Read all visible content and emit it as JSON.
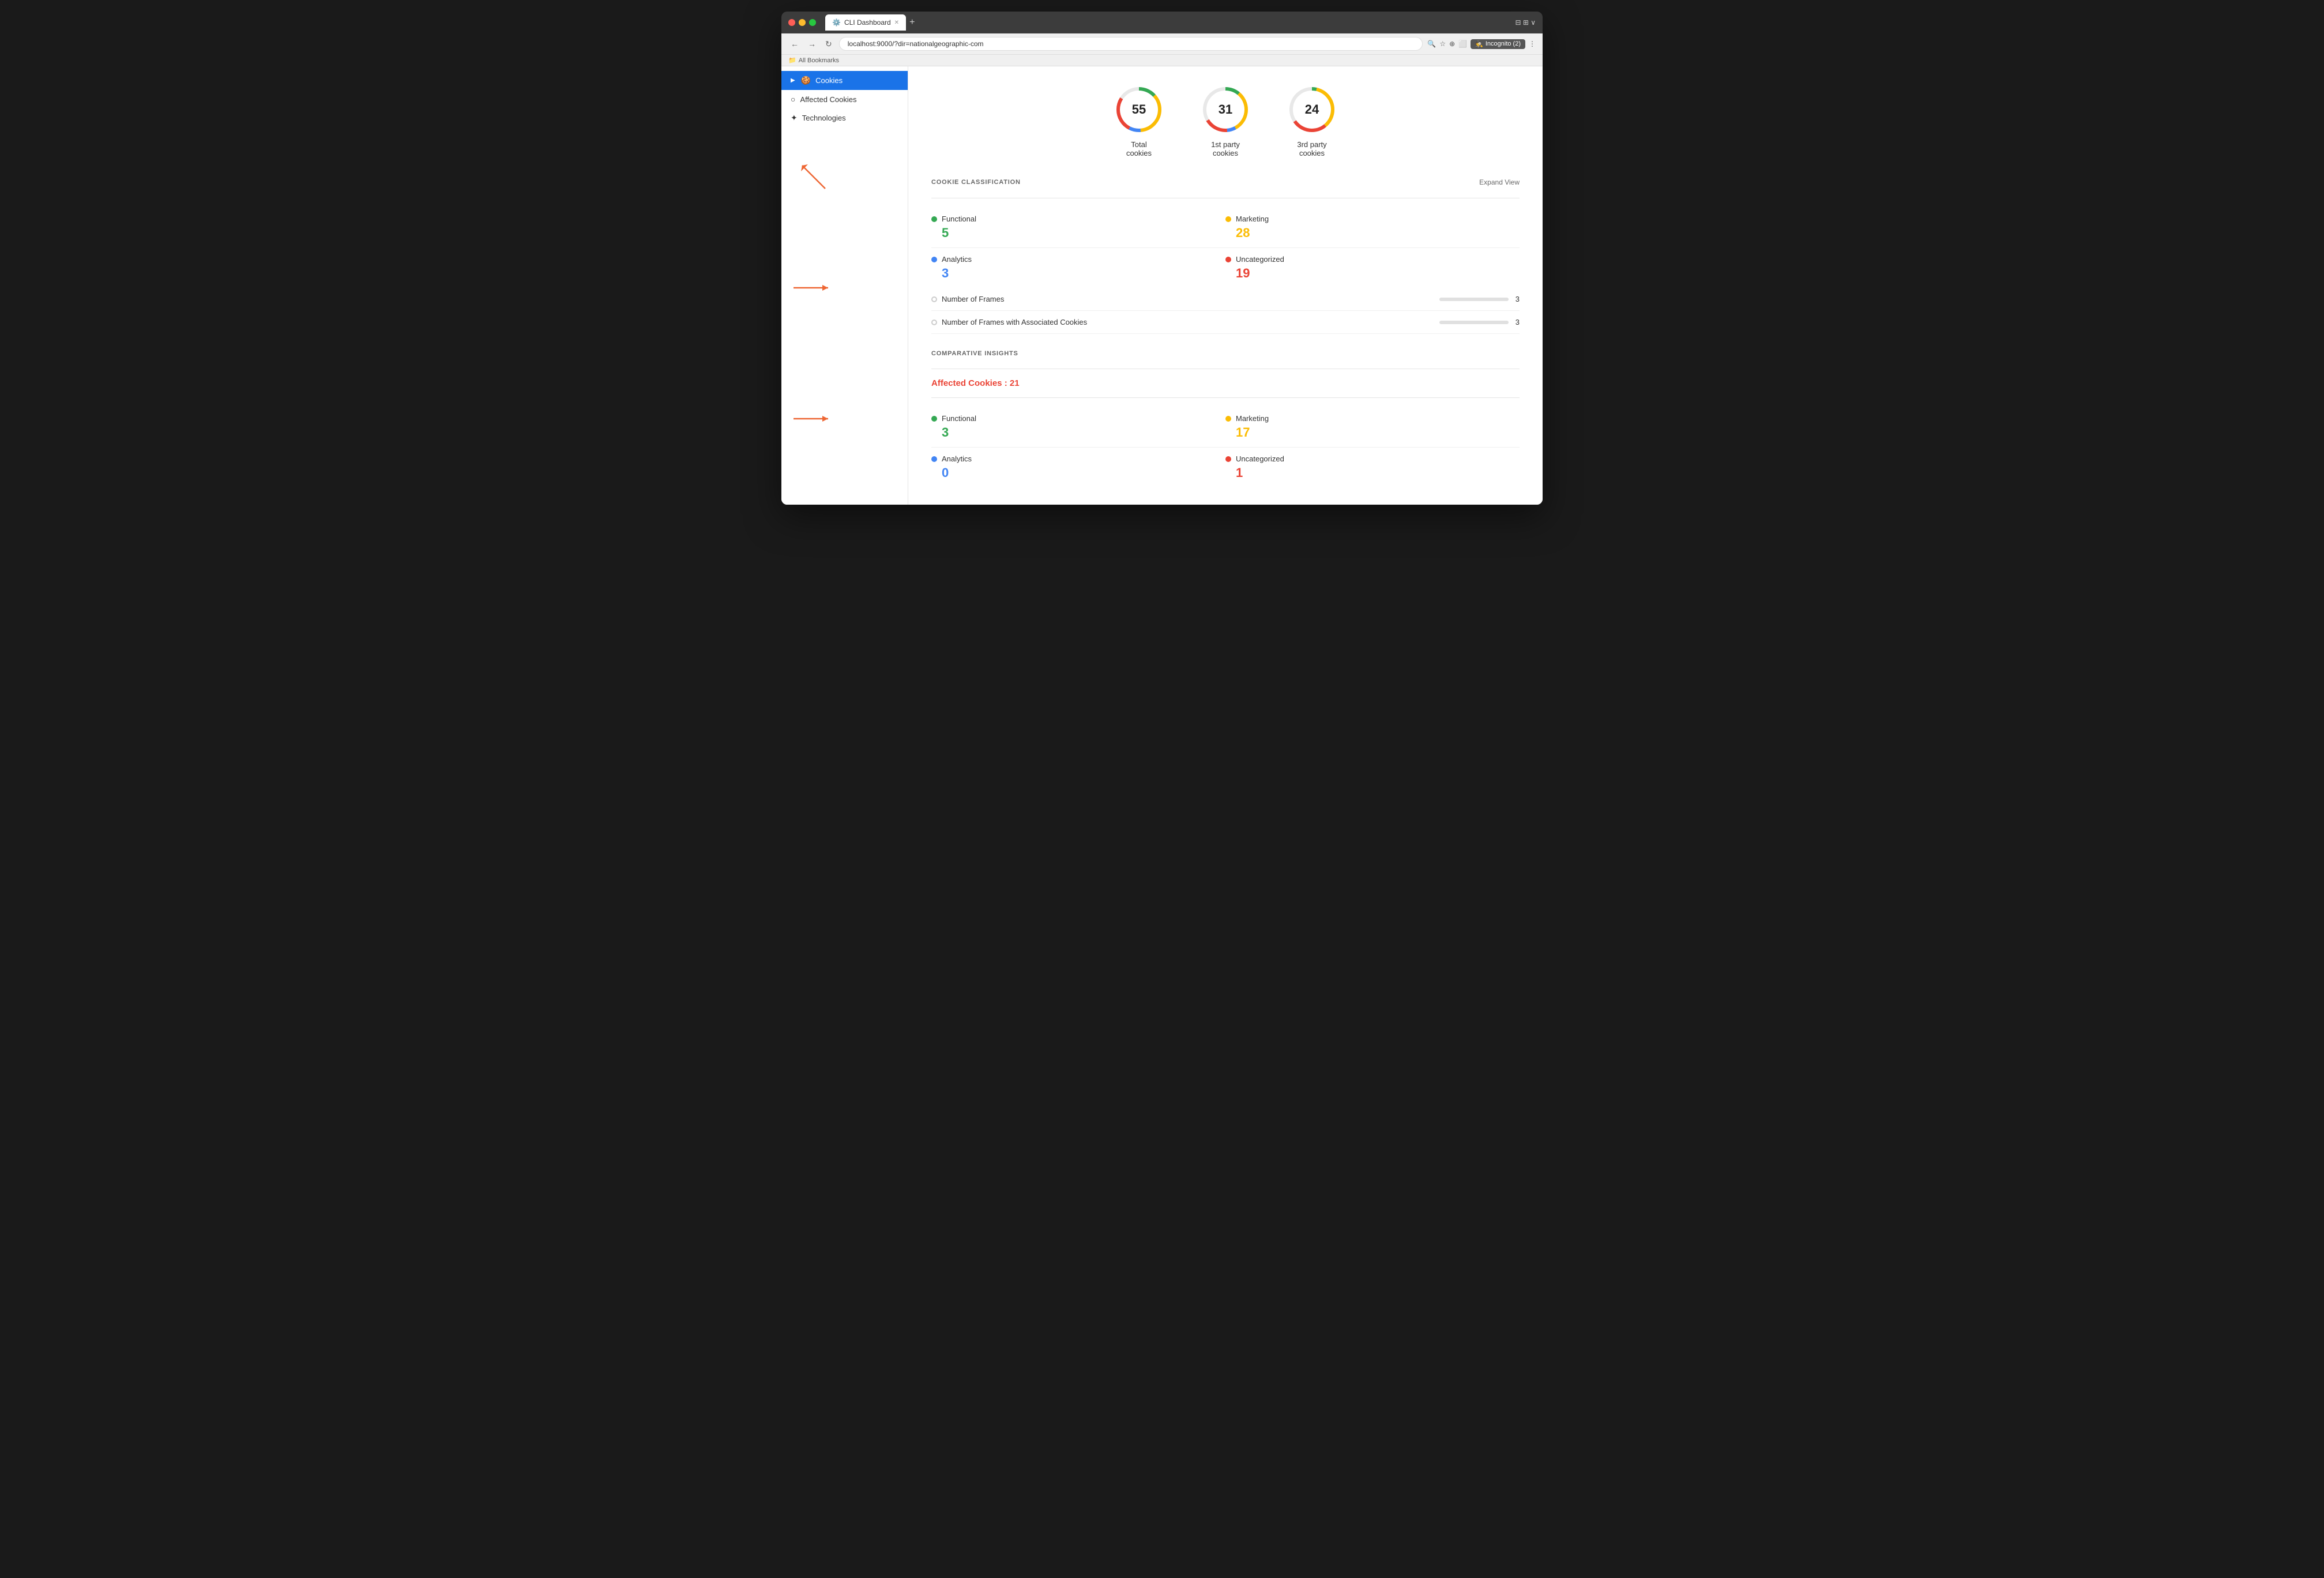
{
  "browser": {
    "tab_title": "CLI Dashboard",
    "url": "localhost:9000/?dir=nationalgeographic-com",
    "incognito_label": "Incognito (2)",
    "bookmarks_label": "All Bookmarks"
  },
  "sidebar": {
    "items": [
      {
        "id": "cookies",
        "label": "Cookies",
        "icon": "🍪",
        "active": true
      },
      {
        "id": "affected-cookies",
        "label": "Affected Cookies",
        "icon": "○",
        "active": false
      },
      {
        "id": "technologies",
        "label": "Technologies",
        "icon": "⊕",
        "active": false
      }
    ]
  },
  "stats": [
    {
      "id": "total",
      "value": "55",
      "title": "Total\ncookies"
    },
    {
      "id": "first-party",
      "value": "31",
      "title": "1st party\ncookies"
    },
    {
      "id": "third-party",
      "value": "24",
      "title": "3rd party\ncookies"
    }
  ],
  "cookie_classification": {
    "section_title": "COOKIE CLASSIFICATION",
    "expand_label": "Expand View",
    "items": [
      {
        "id": "functional",
        "label": "Functional",
        "value": "5",
        "dot": "green",
        "val_color": "green"
      },
      {
        "id": "marketing",
        "label": "Marketing",
        "value": "28",
        "dot": "orange",
        "val_color": "orange"
      },
      {
        "id": "analytics",
        "label": "Analytics",
        "value": "3",
        "dot": "blue",
        "val_color": "blue"
      },
      {
        "id": "uncategorized",
        "label": "Uncategorized",
        "value": "19",
        "dot": "red",
        "val_color": "red"
      }
    ],
    "frames": [
      {
        "id": "frames",
        "label": "Number of Frames",
        "value": "3"
      },
      {
        "id": "frames-with-cookies",
        "label": "Number of Frames with Associated Cookies",
        "value": "3"
      }
    ]
  },
  "comparative_insights": {
    "section_title": "COMPARATIVE INSIGHTS",
    "affected_label": "Affected Cookies : 21",
    "items": [
      {
        "id": "functional",
        "label": "Functional",
        "value": "3",
        "dot": "green",
        "val_color": "green"
      },
      {
        "id": "marketing",
        "label": "Marketing",
        "value": "17",
        "dot": "orange",
        "val_color": "orange"
      },
      {
        "id": "analytics",
        "label": "Analytics",
        "value": "0",
        "dot": "blue",
        "val_color": "blue"
      },
      {
        "id": "uncategorized",
        "label": "Uncategorized",
        "value": "1",
        "dot": "red",
        "val_color": "red"
      }
    ]
  }
}
